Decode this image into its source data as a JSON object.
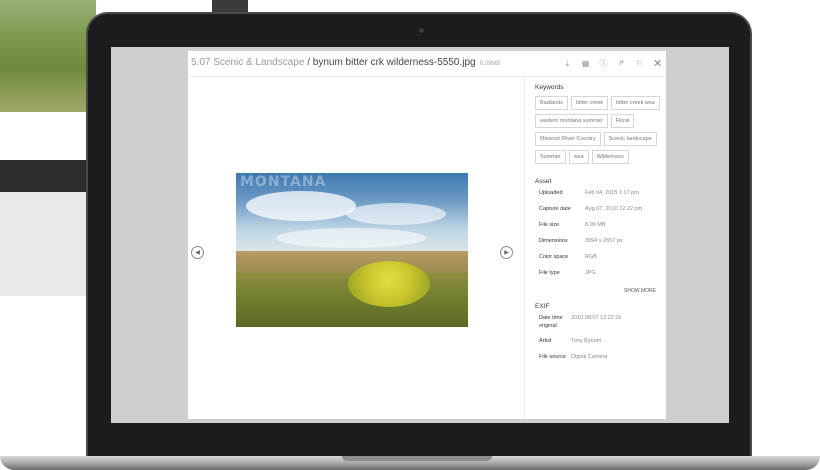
{
  "breadcrumb": {
    "folder": "5.07 Scenic & Landscape",
    "separator": " / ",
    "filename": "bynum bitter crk wilderness-5550.jpg",
    "file_size": "8.09MB"
  },
  "header_icons": [
    "download-icon",
    "grid-icon",
    "info-icon",
    "share-icon",
    "tag-icon",
    "close-icon"
  ],
  "photo": {
    "watermark": "MONTANA"
  },
  "keywords": {
    "title": "Keywords",
    "tags": [
      "Badlands",
      "bitter creek",
      "bitter creek wsa",
      "eastern montana summer",
      "Floral",
      "Missouri River Country",
      "Scenic landscape",
      "Summer",
      "wsa",
      "Wilderness"
    ]
  },
  "asset": {
    "title": "Asset",
    "rows": [
      {
        "label": "Uploaded",
        "value": "Feb 04, 2015 1:17 pm"
      },
      {
        "label": "Capture date",
        "value": "Aug 07, 2010 12:22 pm"
      },
      {
        "label": "File size",
        "value": "8.09 MB"
      },
      {
        "label": "Dimensions",
        "value": "3994 x 2657 px"
      },
      {
        "label": "Color space",
        "value": "RGB"
      },
      {
        "label": "File type",
        "value": "JPG"
      }
    ],
    "show_more": "SHOW MORE"
  },
  "exif": {
    "title": "EXIF",
    "rows": [
      {
        "label": "Date time original",
        "value": "2010:08:07 12:22:16"
      },
      {
        "label": "Artist",
        "value": "Tony Bynum"
      },
      {
        "label": "File source",
        "value": "Digital Camera"
      }
    ]
  }
}
